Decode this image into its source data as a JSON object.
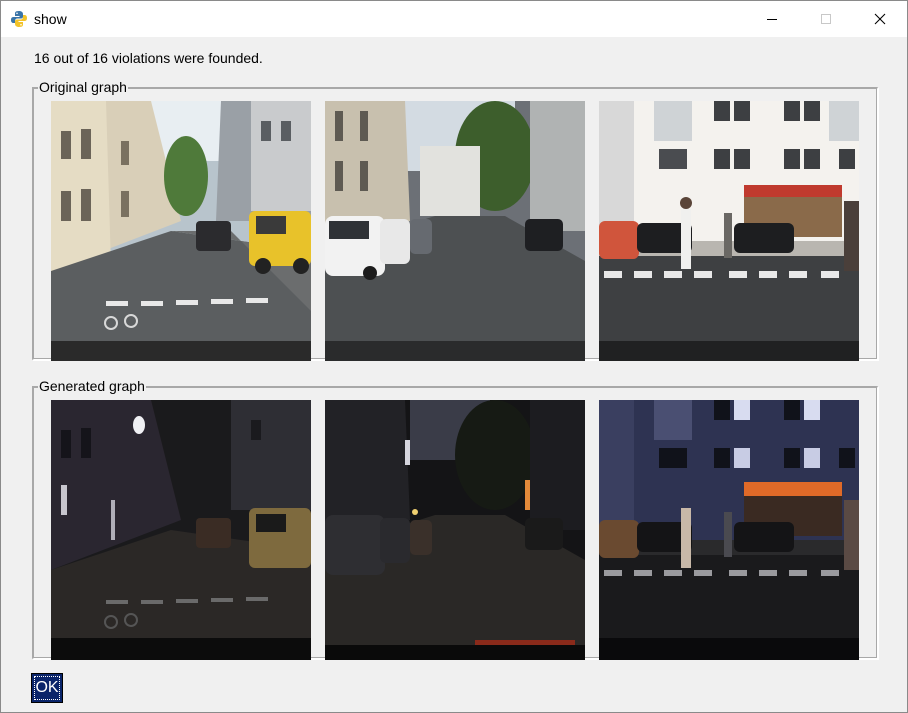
{
  "window": {
    "title": "show"
  },
  "status_text": "16 out of 16 violations were founded.",
  "original_group": {
    "label": "Original graph",
    "images": [
      {
        "name": "original-image-1",
        "scene": "street-daytime"
      },
      {
        "name": "original-image-2",
        "scene": "street-daytime"
      },
      {
        "name": "original-image-3",
        "scene": "crosswalk-daytime"
      }
    ]
  },
  "generated_group": {
    "label": "Generated graph",
    "images": [
      {
        "name": "generated-image-1",
        "scene": "street-night"
      },
      {
        "name": "generated-image-2",
        "scene": "street-night"
      },
      {
        "name": "generated-image-3",
        "scene": "crosswalk-night"
      }
    ]
  },
  "ok_button": {
    "label": "OK"
  },
  "colors": {
    "ok_background": "#0a246a",
    "window_background": "#f0f0f0"
  }
}
